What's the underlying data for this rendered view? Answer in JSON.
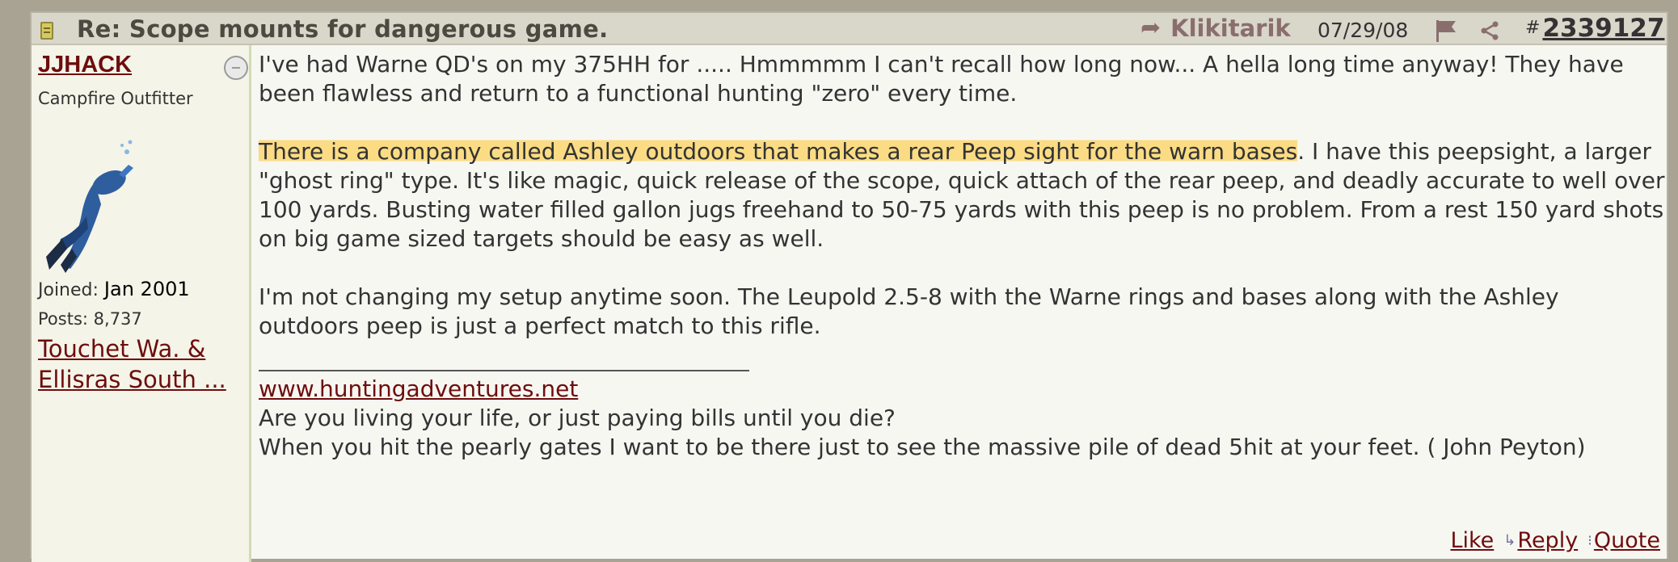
{
  "header": {
    "subject": "Re: Scope mounts for dangerous game.",
    "reply_to_user": "Klikitarik",
    "date": "07/29/08",
    "post_hash": "#",
    "post_number": "2339127"
  },
  "author": {
    "username": "JJHACK",
    "title": "Campfire Outfitter",
    "joined_label": "Joined:",
    "joined_value": "Jan 2001",
    "posts_label": "Posts:",
    "posts_value": "8,737",
    "location": "Touchet Wa. & Ellisras South ..."
  },
  "body": {
    "paragraph1": "I've had Warne QD's on my 375HH for ..... Hmmmmm I can't recall how long now... A hella long time anyway! They have been flawless and return to a functional hunting \"zero\" every time.",
    "paragraph2_highlight": "There is a company called Ashley outdoors that makes a rear Peep sight for the warn bases",
    "paragraph2_rest": ". I have this peepsight, a larger \"ghost ring\" type. It's like magic, quick release of the scope, quick attach of the rear peep, and deadly accurate to well over 100 yards. Busting water filled gallon jugs freehand to 50-75 yards with this peep is no problem. From a rest 150 yard shots on big game sized targets should be easy as well.",
    "paragraph3": "I'm not changing my setup anytime soon. The Leupold 2.5-8 with the Warne rings and bases along with the Ashley outdoors peep is just a perfect match to this rifle."
  },
  "signature": {
    "link": "www.huntingadventures.net",
    "line1": "Are you living your life, or just paying bills until you die?",
    "line2": "When you hit the pearly gates I want to be there just to see the massive pile of dead 5hit at your feet. ( John Peyton)"
  },
  "actions": {
    "like": "Like",
    "reply": "Reply",
    "quote": "Quote"
  },
  "colors": {
    "username": "#6e0d0d",
    "highlight": "#fbdc84",
    "header_bg": "#d9d6ca",
    "sidebar_bg": "#f4f4e8"
  },
  "icons": {
    "post": "post-icon",
    "reply_to": "reply-arrow-icon",
    "flag": "flag-icon",
    "share": "share-icon",
    "status": "offline-status-icon"
  }
}
